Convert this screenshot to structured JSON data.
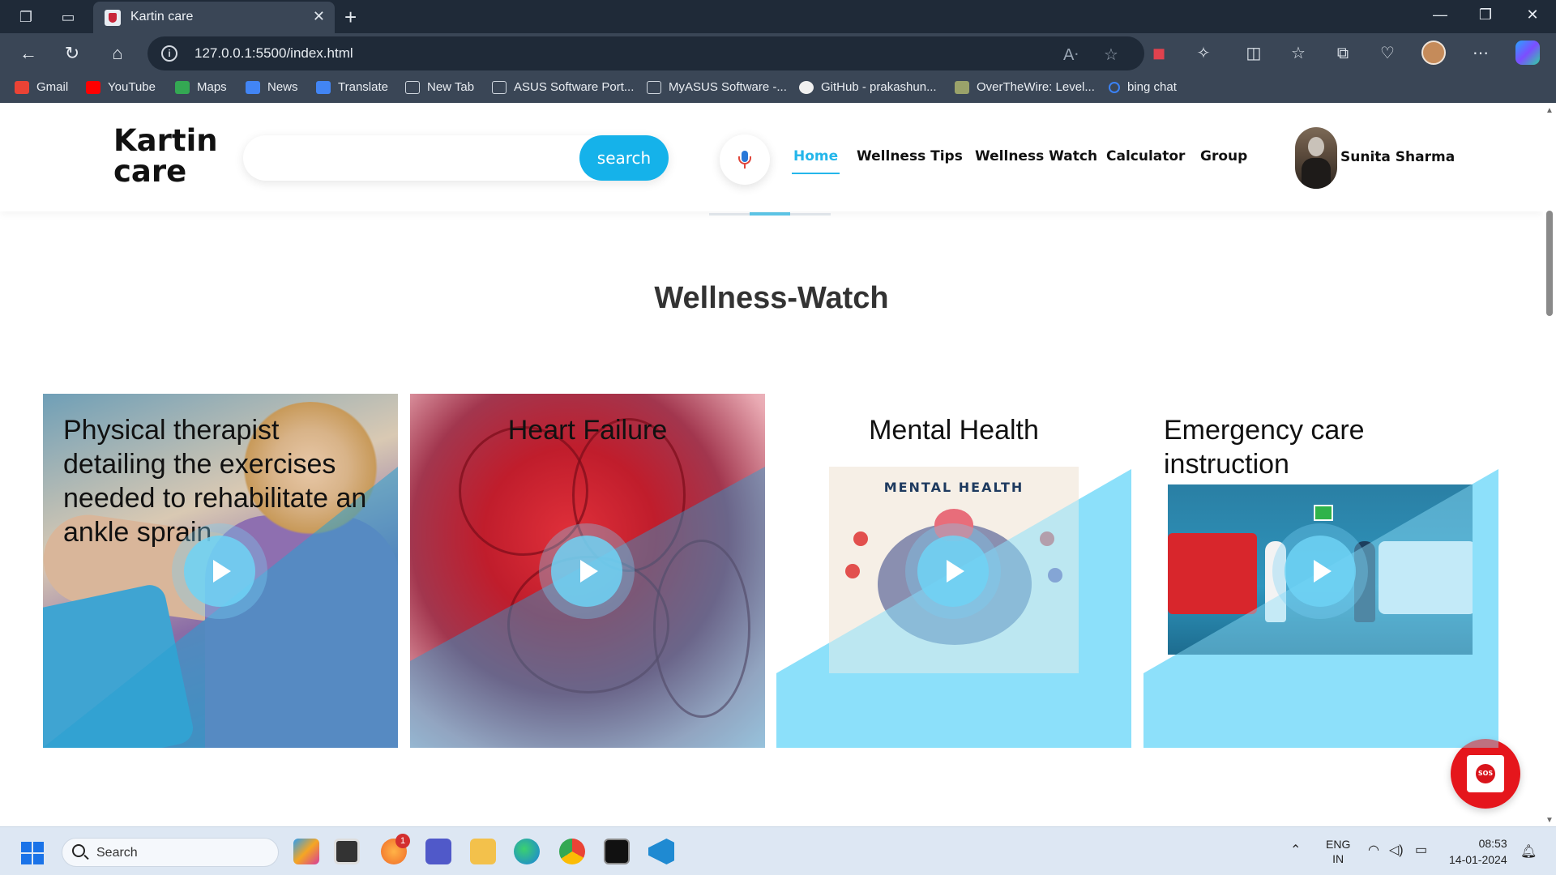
{
  "browser": {
    "tab_title": "Kartin care",
    "url": "127.0.0.1:5500/index.html",
    "bookmarks": [
      {
        "label": "Gmail",
        "color": "#ea4335"
      },
      {
        "label": "YouTube",
        "color": "#ff0000"
      },
      {
        "label": "Maps",
        "color": "#34a853"
      },
      {
        "label": "News",
        "color": "#4285f4"
      },
      {
        "label": "Translate",
        "color": "#4285f4"
      },
      {
        "label": "New Tab",
        "color": "#cfd6de"
      },
      {
        "label": "ASUS Software Port...",
        "color": "#cfd6de"
      },
      {
        "label": "MyASUS Software -...",
        "color": "#cfd6de"
      },
      {
        "label": "GitHub - prakashun...",
        "color": "#f0f0f0"
      },
      {
        "label": "OverTheWire: Level...",
        "color": "#9aa26a"
      },
      {
        "label": "bing chat",
        "color": "#3b82f6"
      }
    ]
  },
  "site": {
    "logo_line1": "Kartin",
    "logo_line2": "care",
    "search_placeholder": "",
    "search_button": "search",
    "nav": [
      {
        "label": "Home",
        "active": true
      },
      {
        "label": "Wellness Tips",
        "active": false
      },
      {
        "label": "Wellness Watch",
        "active": false
      },
      {
        "label": "Calculator",
        "active": false
      },
      {
        "label": "Group",
        "active": false
      }
    ],
    "user_name": "Sunita Sharma",
    "accent_color": "#24b6ea"
  },
  "section": {
    "title": "Wellness-Watch",
    "cards": [
      {
        "title": "Physical therapist detailing the exercises needed to rehabilitate an ankle sprain"
      },
      {
        "title": "Heart Failure"
      },
      {
        "title": "Mental Health",
        "image_text": "MENTAL HEALTH"
      },
      {
        "title": "Emergency care instruction"
      }
    ]
  },
  "sos": {
    "label": "SOS"
  },
  "taskbar": {
    "search_label": "Search",
    "badge_count": "1",
    "language_line1": "ENG",
    "language_line2": "IN",
    "time": "08:53",
    "date": "14-01-2024"
  }
}
